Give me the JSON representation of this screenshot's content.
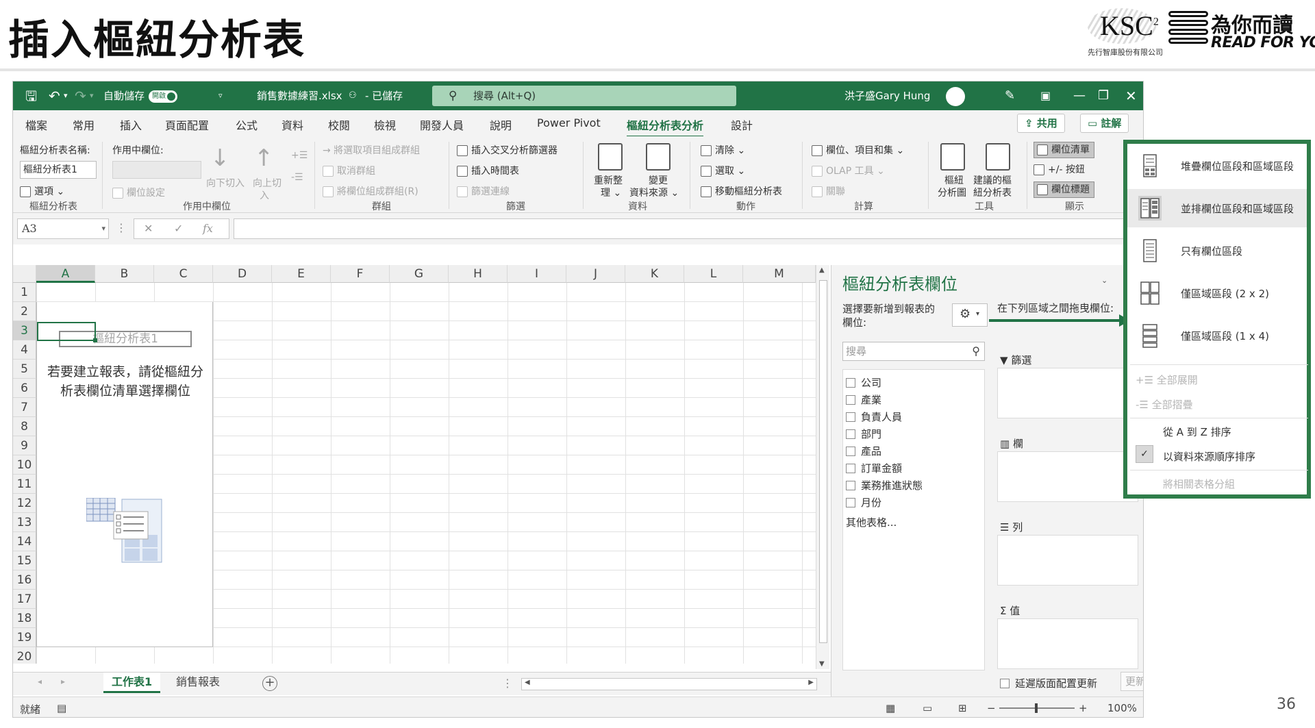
{
  "slide": {
    "title": "插入樞紐分析表",
    "page_number": "36",
    "logos": {
      "ksc_text": "KSC",
      "ksc_sup": "2",
      "ksc_sub": "先行智庫股份有限公司",
      "rfy_cn": "為你而讀",
      "rfy_en": "READ FOR YOU"
    }
  },
  "excel": {
    "titlebar": {
      "autosave_label": "自動儲存",
      "autosave_state": "開啟",
      "filename": "銷售數據練習.xlsx",
      "save_status": "- 已儲存",
      "search_placeholder": "搜尋 (Alt+Q)",
      "user_name": "洪子盛Gary Hung"
    },
    "menu": {
      "tabs": [
        "檔案",
        "常用",
        "插入",
        "頁面配置",
        "公式",
        "資料",
        "校閱",
        "檢視",
        "開發人員",
        "說明",
        "Power Pivot",
        "樞紐分析表分析",
        "設計"
      ],
      "active_tab": "樞紐分析表分析",
      "share_label": "共用",
      "comment_label": "註解"
    },
    "ribbon": {
      "pivot_name_label": "樞紐分析表名稱:",
      "pivot_name_value": "樞紐分析表1",
      "options_label": "選項",
      "group_pivot": "樞紐分析表",
      "active_field_label": "作用中欄位:",
      "field_settings": "欄位設定",
      "drill_down_1": "向下切入",
      "drill_up_1": "向上切",
      "drill_up_2": "入",
      "group_active_field": "作用中欄位",
      "group_selection": "將選取項目組成群組",
      "ungroup": "取消群組",
      "group_field": "將欄位組成群組(R)",
      "group_group": "群組",
      "insert_slicer": "插入交叉分析篩選器",
      "insert_timeline": "插入時間表",
      "filter_connections": "篩選連線",
      "group_filter": "篩選",
      "refresh_1": "重新整",
      "refresh_2": "理",
      "change_source_1": "變更",
      "change_source_2": "資料來源",
      "group_data": "資料",
      "clear": "清除",
      "select": "選取",
      "move_pivot": "移動樞紐分析表",
      "group_actions": "動作",
      "fields_items_sets": "欄位、項目和集",
      "olap_tools": "OLAP 工具",
      "relationships": "關聯",
      "group_calc": "計算",
      "pivot_chart_1": "樞紐",
      "pivot_chart_2": "分析圖",
      "recommended_1": "建議的樞",
      "recommended_2": "紐分析表",
      "group_tools": "工具",
      "field_list": "欄位清單",
      "buttons_toggle": "+/- 按鈕",
      "field_headers": "欄位標題",
      "group_show": "顯示"
    },
    "formula_bar": {
      "name_box": "A3",
      "fx": "fx"
    },
    "grid": {
      "columns": [
        "A",
        "B",
        "C",
        "D",
        "E",
        "F",
        "G",
        "H",
        "I",
        "J",
        "K",
        "L",
        "M"
      ],
      "rows": [
        "1",
        "2",
        "3",
        "4",
        "5",
        "6",
        "7",
        "8",
        "9",
        "10",
        "11",
        "12",
        "13",
        "14",
        "15",
        "16",
        "17",
        "18",
        "19",
        "20"
      ],
      "selected_column": "A",
      "selected_row": "3",
      "placeholder_name": "樞紐分析表1",
      "placeholder_msg_1": "若要建立報表，請從樞紐分",
      "placeholder_msg_2": "析表欄位清單選擇欄位"
    },
    "sheets": {
      "tabs": [
        "工作表1",
        "銷售報表"
      ],
      "active": "工作表1"
    },
    "status": {
      "ready": "就緒",
      "zoom": "100%"
    },
    "field_pane": {
      "title": "樞紐分析表欄位",
      "choose_fields": "選擇要新增到報表的欄位:",
      "drag_label": "在下列區域之間拖曳欄位:",
      "search_placeholder": "搜尋",
      "fields": [
        "公司",
        "產業",
        "負責人員",
        "部門",
        "產品",
        "訂單金額",
        "業務推進狀態",
        "月份"
      ],
      "more_tables": "其他表格...",
      "areas": {
        "filters": "篩選",
        "columns": "欄",
        "rows": "列",
        "values": "值"
      },
      "defer_update": "延遲版面配置更新",
      "update_button": "更新"
    },
    "gear_menu": {
      "layouts": [
        "堆疊欄位區段和區域區段",
        "並排欄位區段和區域區段",
        "只有欄位區段",
        "僅區域區段 (2 x 2)",
        "僅區域區段 (1 x 4)"
      ],
      "selected_layout": "並排欄位區段和區域區段",
      "expand_all": "全部展開",
      "collapse_all": "全部摺疊",
      "sort_az": "從 A 到 Z 排序",
      "sort_source": "以資料來源順序排序",
      "group_related": "將相關表格分組"
    }
  }
}
